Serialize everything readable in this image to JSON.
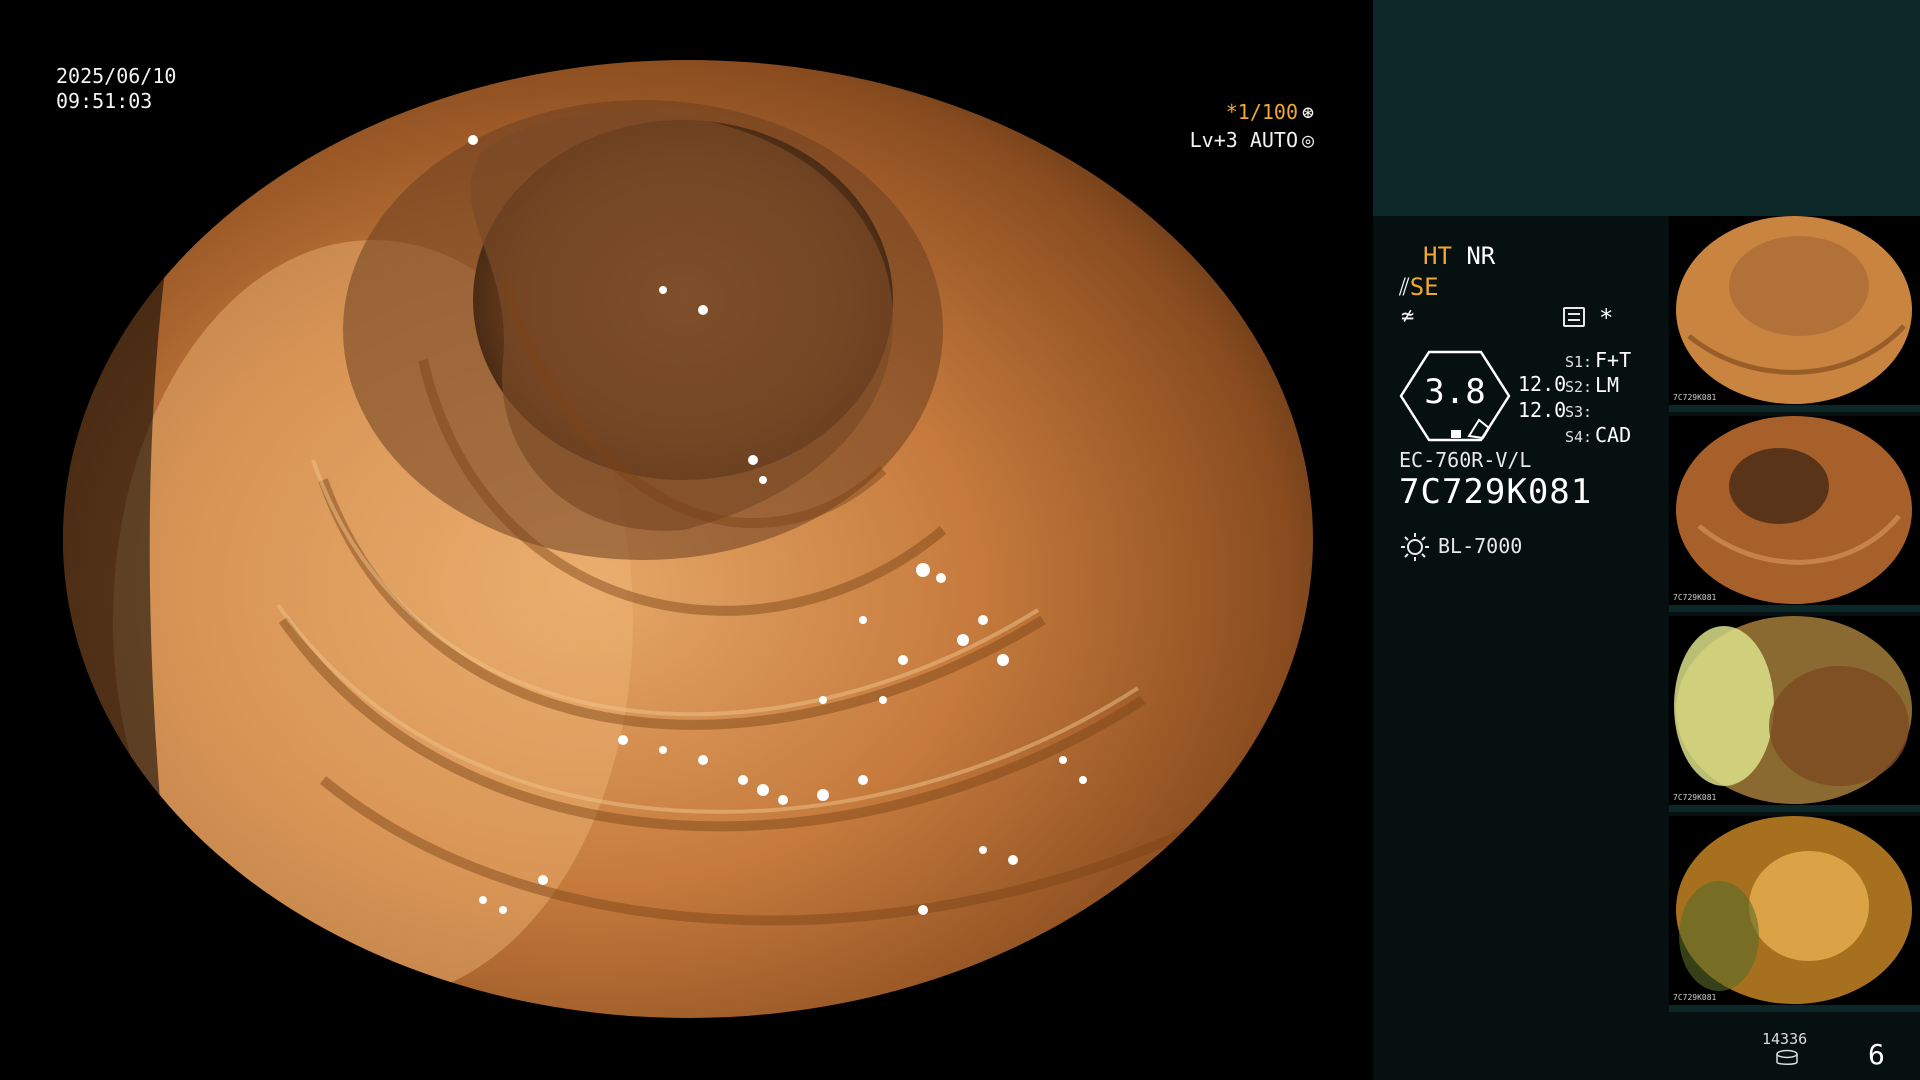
{
  "main_view": {
    "date": "2025/06/10",
    "time": "09:51:03"
  },
  "top_settings": {
    "exposure": "*1/100",
    "exposure_icon": "aperture-icon",
    "level": "Lv+3 AUTO",
    "level_icon": "iris-icon"
  },
  "status": {
    "ht": "HT",
    "nr": "NR",
    "se": "SE",
    "se_icon": "structure-enhance-icon",
    "f_icon": "freeze-icon",
    "menu_icon": "menu-icon",
    "star": "*",
    "zoom": "3.8",
    "enhance_1": "12.0",
    "enhance_2": "12.0",
    "scope_model": "EC-760R-V/L",
    "scope_serial": "7C729K081",
    "light_icon": "light-source-icon",
    "light_source": "BL-7000"
  },
  "switches": [
    {
      "key": "S1:",
      "value": "F+T"
    },
    {
      "key": "S2:",
      "value": "LM"
    },
    {
      "key": "S3:",
      "value": ""
    },
    {
      "key": "S4:",
      "value": "CAD"
    }
  ],
  "thumbnails": [
    {
      "serial": "7C729K081",
      "tint": "orange"
    },
    {
      "serial": "7C729K081",
      "tint": "brown"
    },
    {
      "serial": "7C729K081",
      "tint": "green"
    },
    {
      "serial": "7C729K081",
      "tint": "gold"
    }
  ],
  "footer": {
    "storage_count": "14336",
    "storage_icon": "storage-disk-icon",
    "capture_count": "6"
  },
  "colors": {
    "panel_bg": "#061010",
    "info_box_bg": "#0b2727",
    "accent": "#f0a830"
  }
}
